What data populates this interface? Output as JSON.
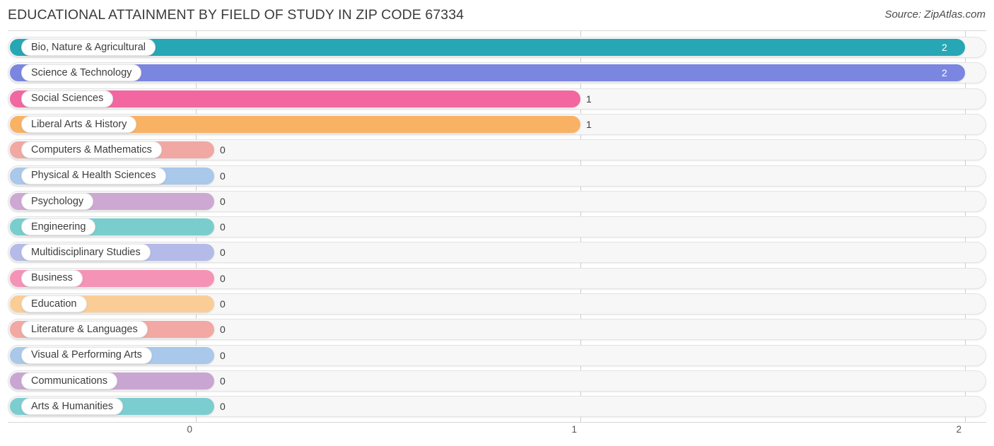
{
  "header": {
    "title": "EDUCATIONAL ATTAINMENT BY FIELD OF STUDY IN ZIP CODE 67334",
    "source": "Source: ZipAtlas.com"
  },
  "chart_data": {
    "type": "bar",
    "orientation": "horizontal",
    "title": "EDUCATIONAL ATTAINMENT BY FIELD OF STUDY IN ZIP CODE 67334",
    "xlabel": "",
    "ylabel": "",
    "xlim": [
      0,
      2
    ],
    "grid": true,
    "legend": "none",
    "tick_labels": [
      "0",
      "1",
      "2"
    ],
    "tick_values": [
      0,
      1,
      2
    ],
    "categories": [
      "Bio, Nature & Agricultural",
      "Science & Technology",
      "Social Sciences",
      "Liberal Arts & History",
      "Computers & Mathematics",
      "Physical & Health Sciences",
      "Psychology",
      "Engineering",
      "Multidisciplinary Studies",
      "Business",
      "Education",
      "Literature & Languages",
      "Visual & Performing Arts",
      "Communications",
      "Arts & Humanities"
    ],
    "values": [
      2,
      2,
      1,
      1,
      0,
      0,
      0,
      0,
      0,
      0,
      0,
      0,
      0,
      0,
      0
    ],
    "value_labels": [
      "2",
      "2",
      "1",
      "1",
      "0",
      "0",
      "0",
      "0",
      "0",
      "0",
      "0",
      "0",
      "0",
      "0",
      "0"
    ],
    "colors": [
      "#27a6b5",
      "#7b86e0",
      "#f2679f",
      "#f9b264",
      "#f1a8a3",
      "#a9c8ea",
      "#cda8d2",
      "#79cdcd",
      "#b4bbe8",
      "#f593b6",
      "#fbcd96",
      "#f2a8a3",
      "#a9c8ea",
      "#c9a6d2",
      "#7ccdd0"
    ]
  }
}
